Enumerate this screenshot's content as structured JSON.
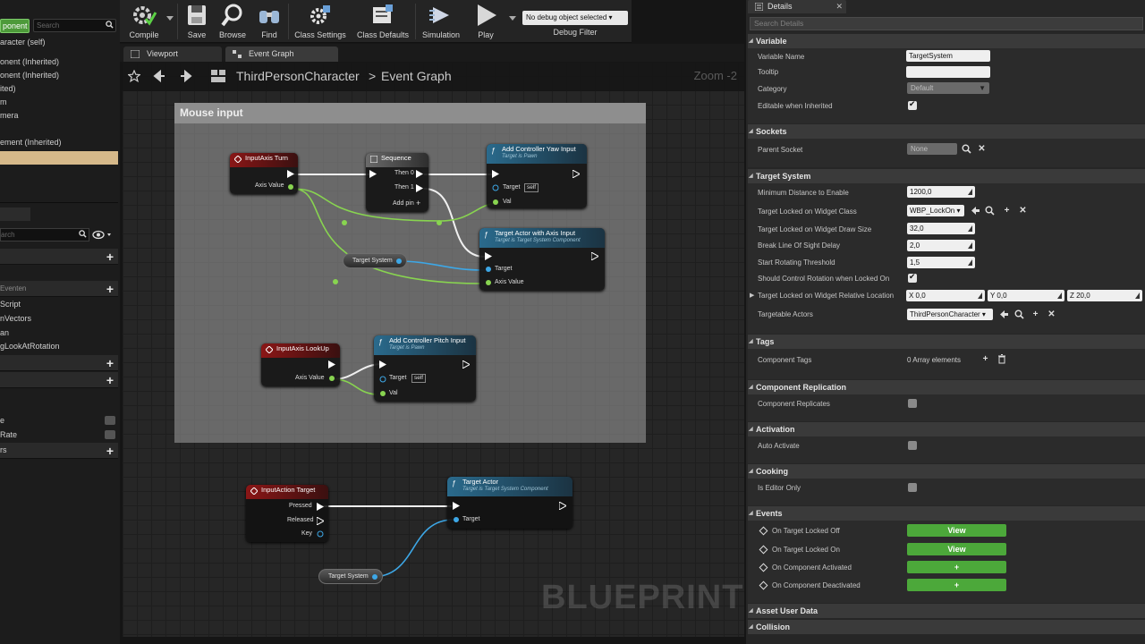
{
  "left_panel": {
    "add_component_label": "ponent ▾",
    "search_placeholder": "Search",
    "components": [
      "aracter (self)",
      "onent (Inherited)",
      "onent (Inherited)",
      "ited)",
      "m",
      "mera",
      "",
      "ement (Inherited)"
    ],
    "my_search_placeholder": "arch",
    "items": [
      "Eventen",
      "Script",
      "nVectors",
      "an",
      "gLookAtRotation"
    ],
    "bottom_items": [
      "e",
      "Rate",
      "rs"
    ]
  },
  "toolbar": {
    "compile": "Compile",
    "save": "Save",
    "browse": "Browse",
    "find": "Find",
    "class_settings": "Class Settings",
    "class_defaults": "Class Defaults",
    "simulation": "Simulation",
    "play": "Play",
    "debug_object": "No debug object selected ▾",
    "debug_filter": "Debug Filter"
  },
  "tabs": {
    "viewport": "Viewport",
    "event_graph": "Event Graph"
  },
  "graph": {
    "crumb_root": "ThirdPersonCharacter",
    "crumb_sep": ">",
    "crumb_leaf": "Event Graph",
    "zoom": "Zoom -2",
    "comment": "Mouse input",
    "watermark": "BLUEPRINT",
    "nodes": {
      "turn": {
        "title": "InputAxis Turn",
        "pin": "Axis Value"
      },
      "sequence": {
        "title": "Sequence",
        "then0": "Then 0",
        "then1": "Then 1",
        "add_pin": "Add pin"
      },
      "yaw": {
        "title": "Add Controller Yaw Input",
        "sub": "Target is Pawn",
        "target": "Target",
        "self": "self",
        "val": "Val"
      },
      "target_axis": {
        "title": "Target Actor with Axis Input",
        "sub": "Target is Target System Component",
        "target": "Target",
        "axis": "Axis Value"
      },
      "var1": "Target System",
      "lookup": {
        "title": "InputAxis LookUp",
        "pin": "Axis Value"
      },
      "pitch": {
        "title": "Add Controller Pitch Input",
        "sub": "Target is Pawn",
        "target": "Target",
        "self": "self",
        "val": "Val"
      },
      "action": {
        "title": "InputAction Target",
        "pressed": "Pressed",
        "released": "Released",
        "key": "Key"
      },
      "target_actor": {
        "title": "Target Actor",
        "sub": "Target is Target System Component",
        "target": "Target"
      },
      "var2": "Target System"
    }
  },
  "details": {
    "tab": "Details",
    "search_placeholder": "Search Details",
    "sections": {
      "variable": "Variable",
      "sockets": "Sockets",
      "target_system": "Target System",
      "tags": "Tags",
      "component_replication": "Component Replication",
      "activation": "Activation",
      "cooking": "Cooking",
      "events": "Events",
      "asset_user_data": "Asset User Data",
      "collision": "Collision"
    },
    "variable": {
      "name_label": "Variable Name",
      "name_value": "TargetSystem",
      "tooltip_label": "Tooltip",
      "tooltip_value": "",
      "category_label": "Category",
      "category_value": "Default",
      "editable_label": "Editable when Inherited"
    },
    "sockets": {
      "parent_label": "Parent Socket",
      "parent_value": "None"
    },
    "target_system": {
      "min_dist_label": "Minimum Distance to Enable",
      "min_dist_value": "1200,0",
      "widget_class_label": "Target Locked on Widget Class",
      "widget_class_value": "WBP_LockOn ▾",
      "draw_size_label": "Target Locked on Widget Draw Size",
      "draw_size_value": "32,0",
      "break_los_label": "Break Line Of Sight Delay",
      "break_los_value": "2,0",
      "rot_thresh_label": "Start Rotating Threshold",
      "rot_thresh_value": "1,5",
      "ctrl_rot_label": "Should Control Rotation when Locked On",
      "rel_loc_label": "Target Locked on Widget Relative Location",
      "x_value": "X  0,0",
      "y_value": "Y  0,0",
      "z_value": "Z  20,0",
      "actors_label": "Targetable Actors",
      "actors_value": "ThirdPersonCharacter ▾"
    },
    "tags": {
      "comp_tags_label": "Component Tags",
      "comp_tags_value": "0 Array elements"
    },
    "replication": {
      "label": "Component Replicates"
    },
    "activation": {
      "label": "Auto Activate"
    },
    "cooking": {
      "label": "Is Editor Only"
    },
    "events": [
      {
        "label": "On Target Locked Off",
        "button": "View"
      },
      {
        "label": "On Target Locked On",
        "button": "View"
      },
      {
        "label": "On Component Activated",
        "button": "+"
      },
      {
        "label": "On Component Deactivated",
        "button": "+"
      }
    ]
  }
}
